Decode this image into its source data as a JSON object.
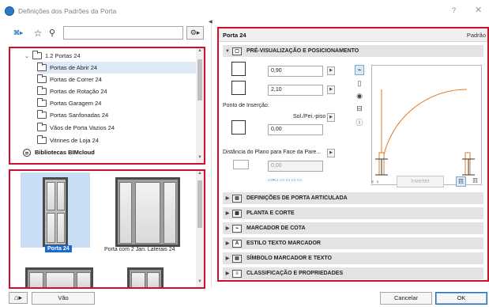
{
  "window": {
    "title": "Definições dos Padrões da Porta",
    "help": "?",
    "close": "✕"
  },
  "toolbar": {
    "search_value": "",
    "search_placeholder": ""
  },
  "tree": {
    "parent": "1.2 Portas 24",
    "items": [
      {
        "label": "Portas de Abrir 24",
        "selected": true
      },
      {
        "label": "Portas de Correr 24",
        "selected": false
      },
      {
        "label": "Portas de Rotação 24",
        "selected": false
      },
      {
        "label": "Portas Garagem 24",
        "selected": false
      },
      {
        "label": "Portas Sanfonadas 24",
        "selected": false
      },
      {
        "label": "Vãos de Porta Vazios 24",
        "selected": false
      },
      {
        "label": "Vitrines de Loja 24",
        "selected": false
      }
    ],
    "bimcloud": "Bibliotecas BIMcloud"
  },
  "thumbnails": [
    {
      "label": "Porta 24",
      "selected": true
    },
    {
      "label": "Porta com 2 Jan. Laterais 24",
      "selected": false
    }
  ],
  "bottom_left": {
    "vao_label": "Vão"
  },
  "right": {
    "title": "Porta 24",
    "default_label": "Padrão",
    "preview_section": "PRÉ-VISUALIZAÇÃO E POSICIONAMENTO",
    "width_value": "0,90",
    "height_value": "2,10",
    "insertion_label": "Ponto de Inserção:",
    "insertion_ref": "Sol./Pei.-piso 1",
    "insertion_value": "0,00",
    "distance_label": "Distância do Plano para Face da Pare...",
    "distance_value": "0,00",
    "inverter_label": "Inverter",
    "sections": [
      "DEFINIÇÕES DE PORTA ARTICULADA",
      "PLANTA E CORTE",
      "MARCADOR DE COTA",
      "ESTILO TEXTO MARCADOR",
      "SÍMBOLO MARCADOR E TEXTO",
      "CLASSIFICAÇÃO E PROPRIEDADES"
    ]
  },
  "footer": {
    "cancel": "Cancelar",
    "ok": "OK"
  },
  "colors": {
    "highlight_border": "#d0102a",
    "selection_blue": "#1d6ad1",
    "door_arc": "#e07a2a"
  }
}
